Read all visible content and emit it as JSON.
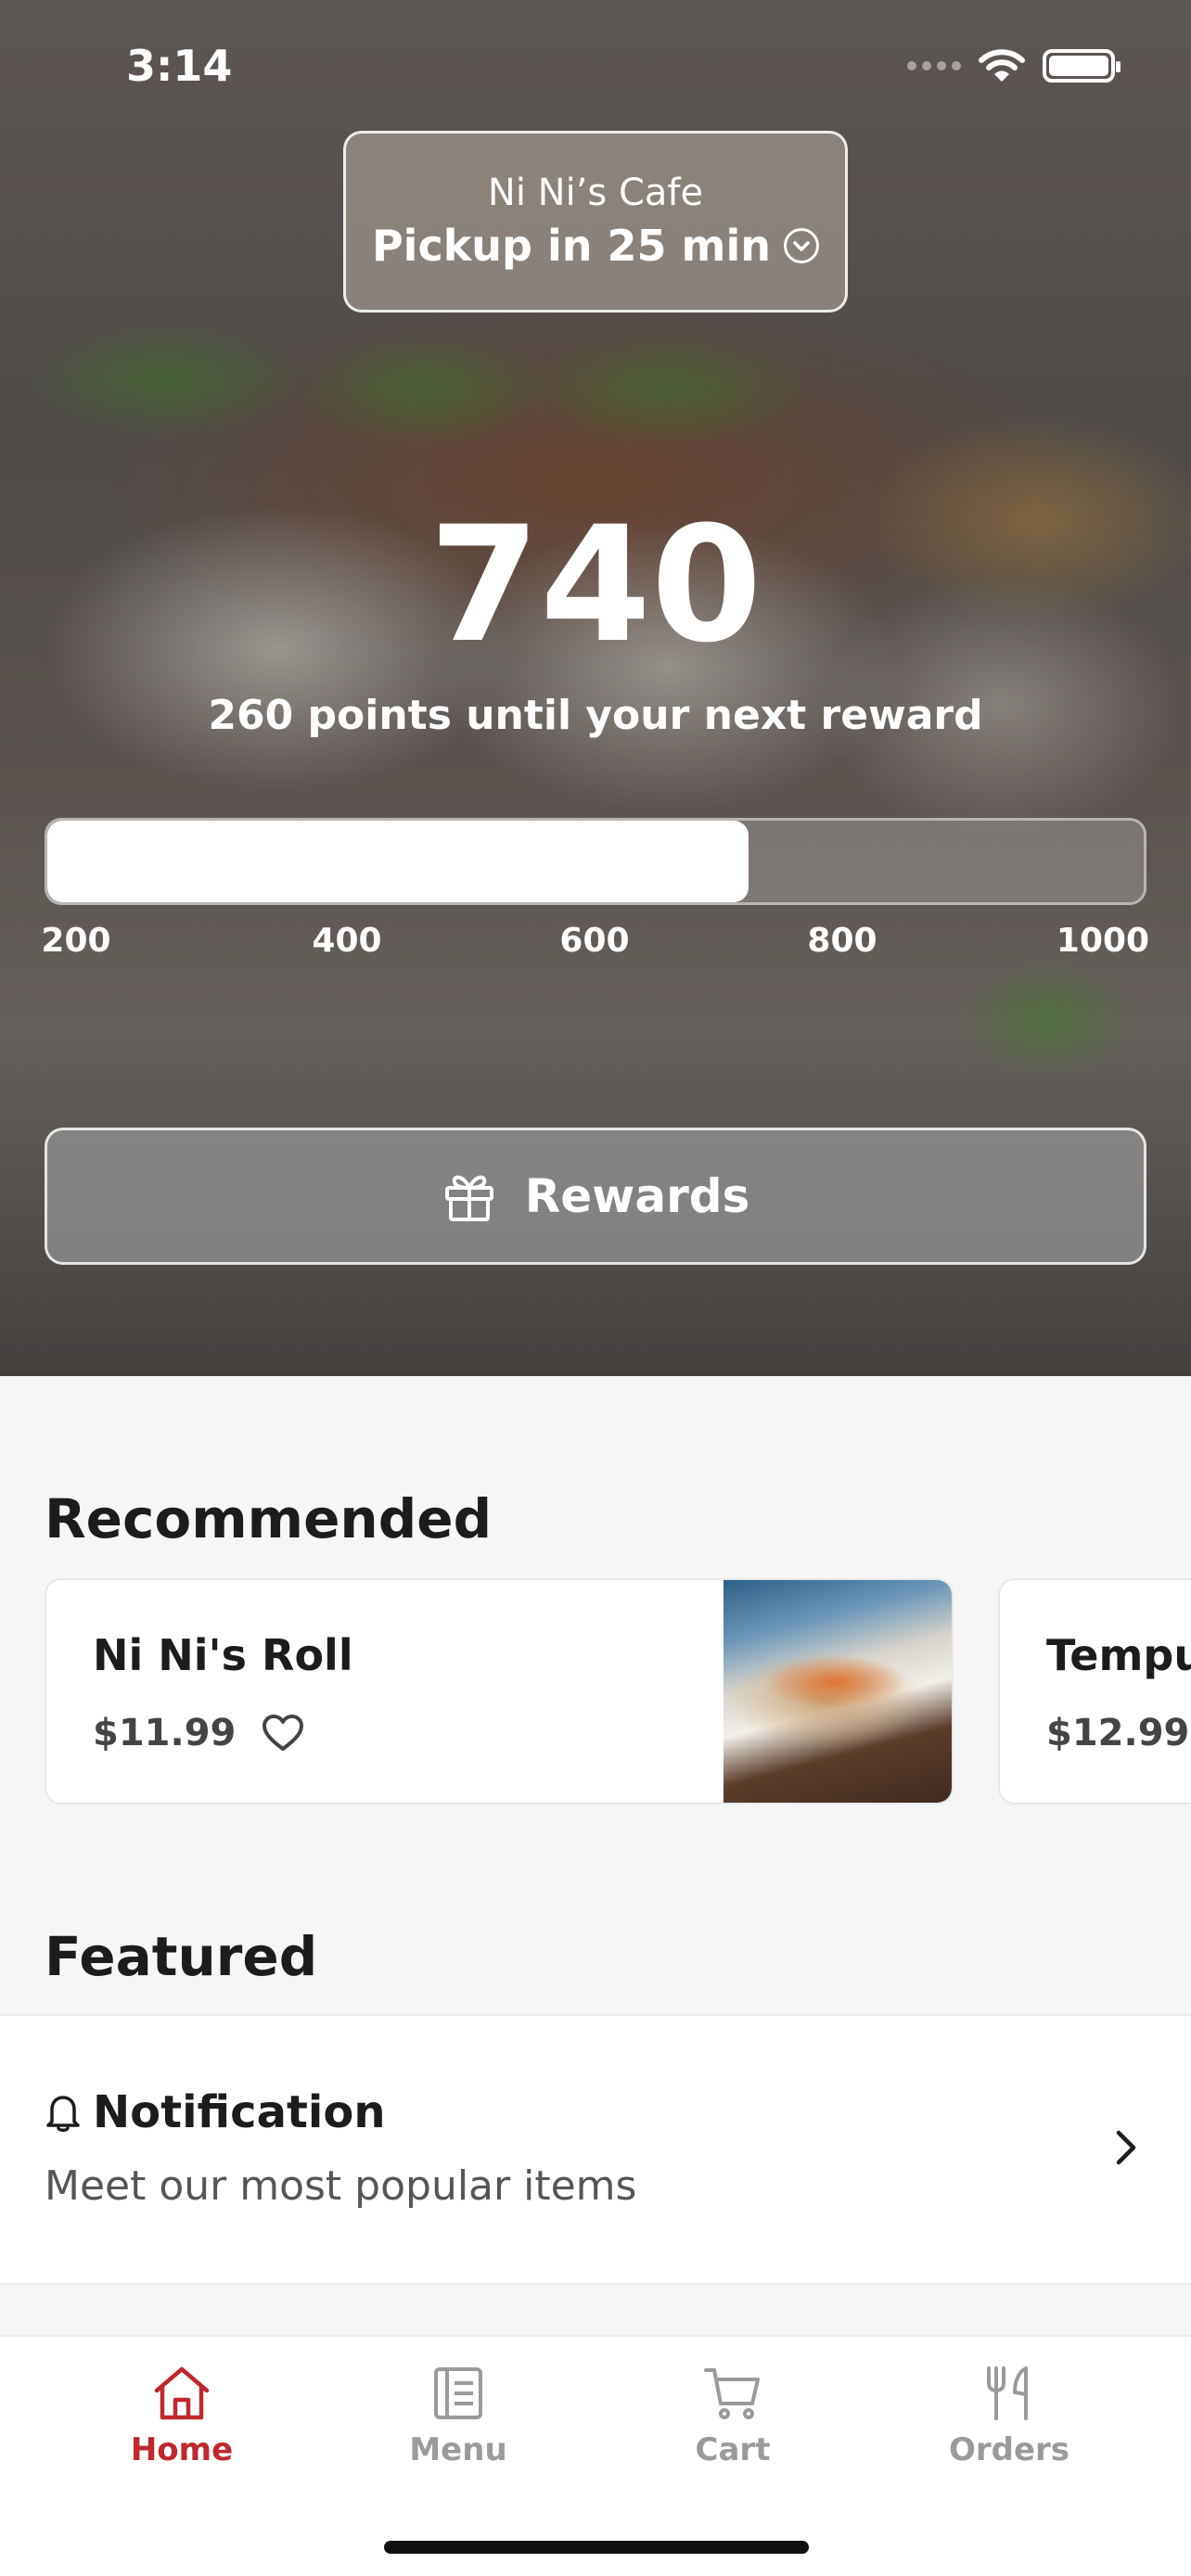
{
  "status_bar": {
    "time": "3:14"
  },
  "location": {
    "name": "Ni Ni’s Cafe",
    "pickup": "Pickup in 25 min",
    "chevron_icon": "chevron-down-circle-icon"
  },
  "loyalty": {
    "points": "740",
    "subtitle": "260 points until your next reward",
    "progress_fraction": 0.64,
    "ticks": [
      "200",
      "400",
      "600",
      "800",
      "1000"
    ]
  },
  "rewards_button": {
    "label": "Rewards",
    "icon": "gift-icon"
  },
  "recommended": {
    "title": "Recommended",
    "items": [
      {
        "name": "Ni Ni's Roll",
        "price": "$11.99",
        "favorite_icon": "heart-outline-icon"
      },
      {
        "name": "Tempu",
        "price": "$12.99"
      }
    ]
  },
  "featured": {
    "title": "Featured",
    "item": {
      "label": "Notification",
      "description": "Meet our most popular items",
      "icon": "bell-icon"
    }
  },
  "tab_bar": {
    "tabs": [
      {
        "label": "Home",
        "icon": "home-icon",
        "active": true
      },
      {
        "label": "Menu",
        "icon": "menu-icon",
        "active": false
      },
      {
        "label": "Cart",
        "icon": "cart-icon",
        "active": false
      },
      {
        "label": "Orders",
        "icon": "utensils-icon",
        "active": false
      }
    ]
  },
  "colors": {
    "accent": "#c0282e",
    "inactive_tab": "#9a9a9a",
    "background": "#f6f6f6"
  }
}
